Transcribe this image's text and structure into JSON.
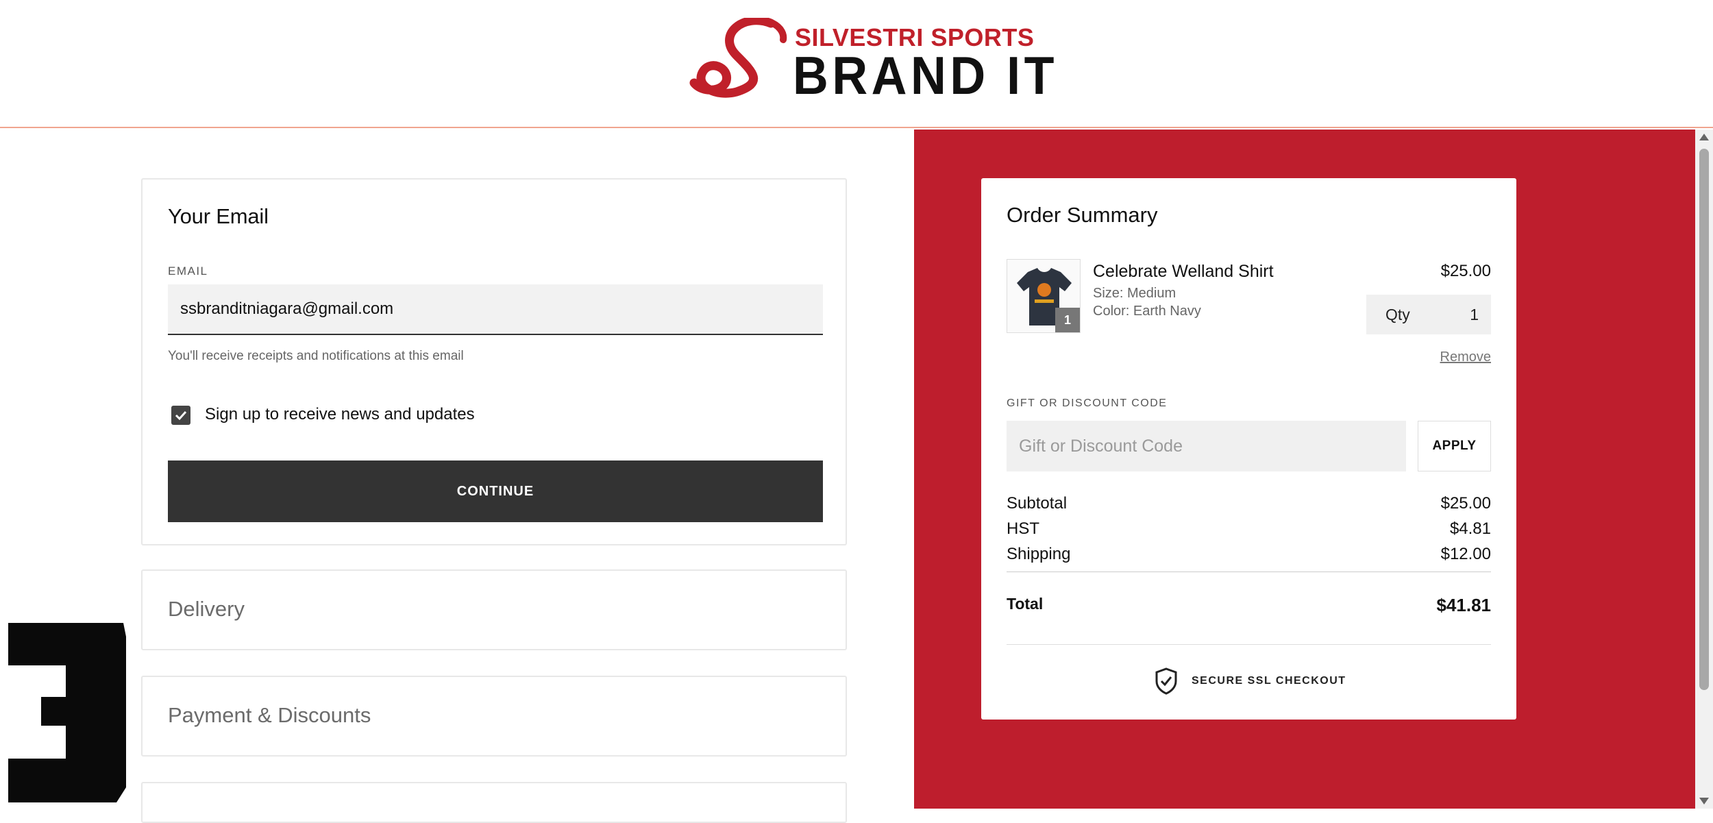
{
  "header": {
    "brand_top": "SILVESTRI SPORTS",
    "brand_bottom": "BRAND IT"
  },
  "email_section": {
    "title": "Your Email",
    "field_label": "EMAIL",
    "email_value": "ssbranditniagara@gmail.com",
    "helper_text": "You'll receive receipts and notifications at this email",
    "newsletter_label": "Sign up to receive news and updates",
    "newsletter_checked": true,
    "continue_label": "CONTINUE"
  },
  "sections": {
    "delivery": "Delivery",
    "payment": "Payment & Discounts"
  },
  "step_number": "3",
  "order_summary": {
    "title": "Order Summary",
    "item": {
      "name": "Celebrate Welland Shirt",
      "size": "Size: Medium",
      "color": "Color: Earth Navy",
      "price": "$25.00",
      "qty_label": "Qty",
      "qty_value": "1",
      "badge_count": "1",
      "remove_label": "Remove"
    },
    "gift": {
      "label": "GIFT OR DISCOUNT CODE",
      "placeholder": "Gift or Discount Code",
      "apply_label": "APPLY"
    },
    "subtotal_label": "Subtotal",
    "subtotal_value": "$25.00",
    "hst_label": "HST",
    "hst_value": "$4.81",
    "shipping_label": "Shipping",
    "shipping_value": "$12.00",
    "total_label": "Total",
    "total_value": "$41.81",
    "secure_label": "SECURE SSL CHECKOUT"
  },
  "colors": {
    "brand_red": "#be1e2d",
    "button_dark": "#333333"
  }
}
